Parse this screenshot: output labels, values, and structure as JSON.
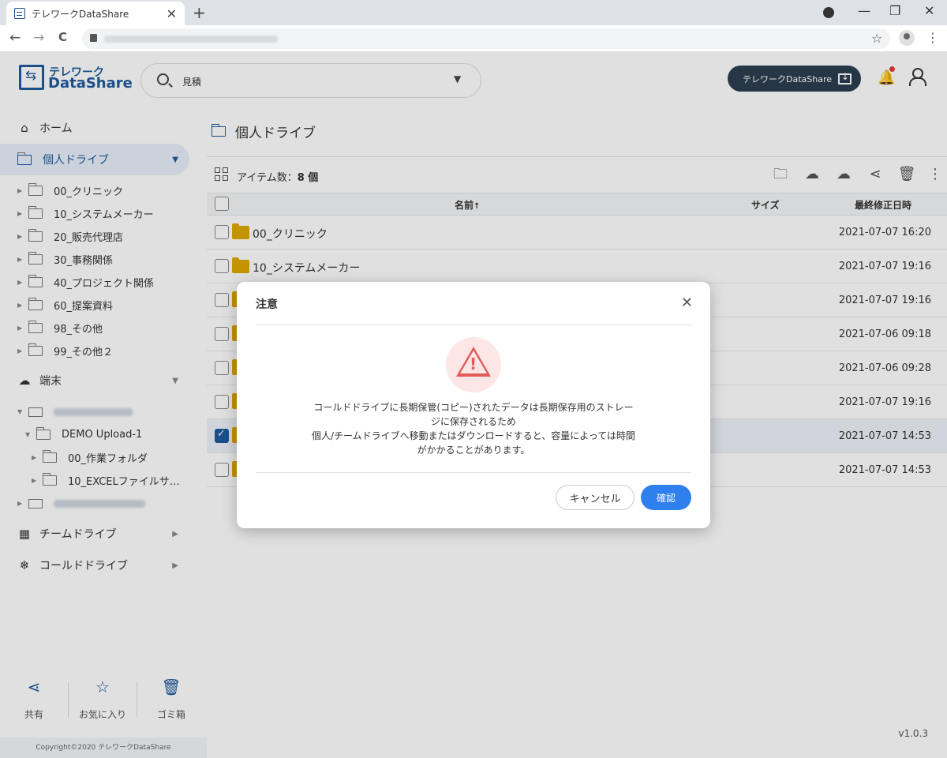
{
  "browser": {
    "tab_title": "テレワークDataShare",
    "close": "✕",
    "new_tab": "+",
    "minimize": "—",
    "restore": "❐",
    "win_close": "✕",
    "back": "←",
    "forward": "→",
    "reload": "C",
    "star": "☆",
    "menu": "⋮"
  },
  "header": {
    "logo_line1": "テレワーク",
    "logo_line2": "DataShare",
    "search_value": "見積",
    "search_caret": "▼",
    "download_button": "テレワークDataShare",
    "bell": "🔔"
  },
  "sidebar": {
    "home": "ホーム",
    "personal_drive": "個人ドライブ",
    "folders": [
      "00_クリニック",
      "10_システムメーカー",
      "20_販売代理店",
      "30_事務関係",
      "40_プロジェクト関係",
      "60_提案資料",
      "98_その他",
      "99_その他２"
    ],
    "device": "端末",
    "device_children": [
      {
        "label": "DEMO Upload-1"
      },
      {
        "label": "00_作業フォルダ"
      },
      {
        "label": "10_EXCELファイルサ…"
      }
    ],
    "team_drive": "チームドライブ",
    "cold_drive": "コールドドライブ",
    "bottom": {
      "share": "共有",
      "favorites": "お気に入り",
      "trash": "ゴミ箱"
    },
    "copyright": "Copyright©2020 テレワークDataShare"
  },
  "main": {
    "breadcrumb": "個人ドライブ",
    "item_count_label": "アイテム数：",
    "item_count_value": "8 個",
    "columns": {
      "name": "名前",
      "size": "サイズ",
      "modified": "最終修正日時"
    },
    "sort_arrow": "↑",
    "rows": [
      {
        "name": "00_クリニック",
        "date": "2021-07-07 16:20",
        "checked": false
      },
      {
        "name": "10_システムメーカー",
        "date": "2021-07-07 19:16",
        "checked": false
      },
      {
        "name": "",
        "date": "2021-07-07 19:16",
        "checked": false
      },
      {
        "name": "",
        "date": "2021-07-06 09:18",
        "checked": false
      },
      {
        "name": "",
        "date": "2021-07-06 09:28",
        "checked": false
      },
      {
        "name": "",
        "date": "2021-07-07 19:16",
        "checked": false
      },
      {
        "name": "",
        "date": "2021-07-07 14:53",
        "checked": true
      },
      {
        "name": "",
        "date": "2021-07-07 14:53",
        "checked": false
      }
    ],
    "version": "v1.0.3"
  },
  "modal": {
    "title": "注意",
    "close": "✕",
    "warning_mark": "!",
    "message_line1": "コールドドライブに長期保管(コピー)されたデータは長期保存用のストレー",
    "message_line2": "ジに保存されるため",
    "message_line3": "個人/チームドライブへ移動またはダウンロードすると、容量によっては時間",
    "message_line4": "がかかることがあります。",
    "cancel": "キャンセル",
    "confirm": "確認"
  },
  "colors": {
    "brand": "#1e5a9c",
    "confirm_button": "#2f80ed",
    "folder": "#e0a800",
    "warning": "#e25a5a",
    "dark_button": "#2c3e50"
  }
}
